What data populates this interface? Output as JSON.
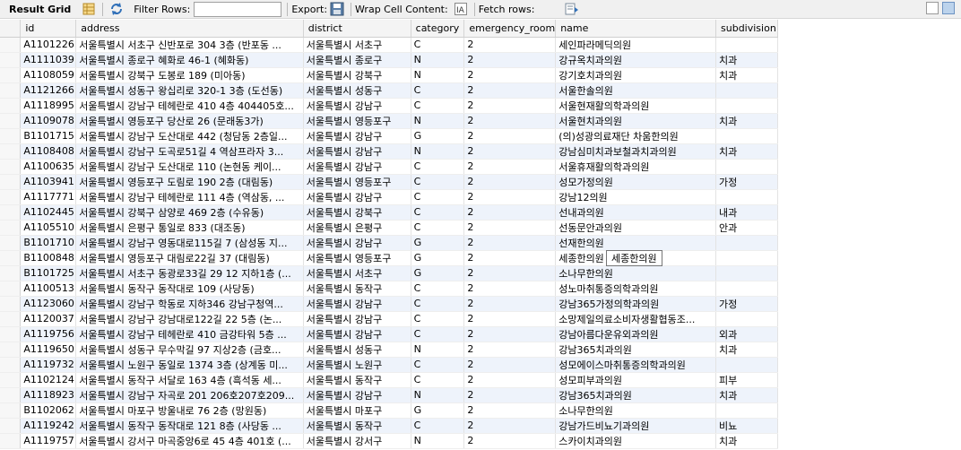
{
  "toolbar": {
    "result_grid": "Result Grid",
    "filter_rows": "Filter Rows:",
    "filter_value": "",
    "export": "Export:",
    "wrap_cell": "Wrap Cell Content:",
    "fetch_rows": "Fetch rows:"
  },
  "columns": [
    "id",
    "address",
    "district",
    "category",
    "emergency_room",
    "name",
    "subdivision"
  ],
  "rows": [
    [
      "A1101226",
      "서울특별시 서초구 신반포로 304 3층 (반포동 ...",
      "서울특별시 서초구",
      "C",
      "2",
      "세인파라메딕의원",
      ""
    ],
    [
      "A1111039",
      "서울특별시 종로구 혜화로 46-1 (혜화동)",
      "서울특별시 종로구",
      "N",
      "2",
      "강규옥치과의원",
      "치과"
    ],
    [
      "A1108059",
      "서울특별시 강북구 도봉로 189 (미아동)",
      "서울특별시 강북구",
      "N",
      "2",
      "강기호치과의원",
      "치과"
    ],
    [
      "A1121266",
      "서울특별시 성동구 왕십리로 320-1 3층 (도선동)",
      "서울특별시 성동구",
      "C",
      "2",
      "서울한솔의원",
      ""
    ],
    [
      "A1118995",
      "서울특별시 강남구 테헤란로 410 4층 404405호...",
      "서울특별시 강남구",
      "C",
      "2",
      "서울현재활의학과의원",
      ""
    ],
    [
      "A1109078",
      "서울특별시 영등포구 당산로 26 (문래동3가)",
      "서울특별시 영등포구",
      "N",
      "2",
      "서울현치과의원",
      "치과"
    ],
    [
      "B1101715",
      "서울특별시 강남구 도산대로 442 (청담동 2층일...",
      "서울특별시 강남구",
      "G",
      "2",
      "(의)성광의료재단 차움한의원",
      ""
    ],
    [
      "A1108408",
      "서울특별시 강남구 도곡로51길 4 역삼프라자 3...",
      "서울특별시 강남구",
      "N",
      "2",
      "강남심미치과보철과치과의원",
      "치과"
    ],
    [
      "A1100635",
      "서울특별시 강남구 도산대로 110 (논현동 케이...",
      "서울특별시 강남구",
      "C",
      "2",
      "서울휴재활의학과의원",
      ""
    ],
    [
      "A1103941",
      "서울특별시 영등포구 도림로 190 2층 (대림동)",
      "서울특별시 영등포구",
      "C",
      "2",
      "성모가정의원",
      "가정"
    ],
    [
      "A1117771",
      "서울특별시 강남구 테헤란로 111 4층 (역삼동, ...",
      "서울특별시 강남구",
      "C",
      "2",
      "강남12의원",
      ""
    ],
    [
      "A1102445",
      "서울특별시 강북구 삼양로 469 2층 (수유동)",
      "서울특별시 강북구",
      "C",
      "2",
      "선내과의원",
      "내과"
    ],
    [
      "A1105510",
      "서울특별시 은평구 통일로 833 (대조동)",
      "서울특별시 은평구",
      "C",
      "2",
      "선동문안과의원",
      "안과"
    ],
    [
      "B1101710",
      "서울특별시 강남구 영동대로115길 7 (삼성동 지...",
      "서울특별시 강남구",
      "G",
      "2",
      "선재한의원",
      ""
    ],
    [
      "B1100848",
      "서울특별시 영등포구 대림로22길 37 (대림동)",
      "서울특별시 영등포구",
      "G",
      "2",
      "세종한의원",
      ""
    ],
    [
      "B1101725",
      "서울특별시 서초구 동광로33길 29 12 지하1층 (...",
      "서울특별시 서초구",
      "G",
      "2",
      "소나무한의원",
      ""
    ],
    [
      "A1100513",
      "서울특별시 동작구 동작대로 109 (사당동)",
      "서울특별시 동작구",
      "C",
      "2",
      "성노마취통증의학과의원",
      ""
    ],
    [
      "A1123060",
      "서울특별시 강남구 학동로 지하346 강남구청역...",
      "서울특별시 강남구",
      "C",
      "2",
      "강남365가정의학과의원",
      "가정"
    ],
    [
      "A1120037",
      "서울특별시 강남구 강남대로122길 22 5층 (논...",
      "서울특별시 강남구",
      "C",
      "2",
      "소망제일의료소비자생활협동조...",
      ""
    ],
    [
      "A1119756",
      "서울특별시 강남구 테헤란로 410 금강타워 5층 ...",
      "서울특별시 강남구",
      "C",
      "2",
      "강남아름다운유외과의원",
      "외과"
    ],
    [
      "A1119650",
      "서울특별시 성동구 무수막길 97 지상2층 (금호...",
      "서울특별시 성동구",
      "N",
      "2",
      "강남365치과의원",
      "치과"
    ],
    [
      "A1119732",
      "서울특별시 노원구 동일로 1374 3층 (상계동 미...",
      "서울특별시 노원구",
      "C",
      "2",
      "성모에이스마취통증의학과의원",
      ""
    ],
    [
      "A1102124",
      "서울특별시 동작구 서달로 163 4층 (흑석동 세...",
      "서울특별시 동작구",
      "C",
      "2",
      "성모피부과의원",
      "피부"
    ],
    [
      "A1118923",
      "서울특별시 강남구 자곡로 201 206호207호209...",
      "서울특별시 강남구",
      "N",
      "2",
      "강남365치과의원",
      "치과"
    ],
    [
      "B1102062",
      "서울특별시 마포구 방울내로 76 2층 (망원동)",
      "서울특별시 마포구",
      "G",
      "2",
      "소나무한의원",
      ""
    ],
    [
      "A1119242",
      "서울특별시 동작구 동작대로 121 8층 (사당동 ...",
      "서울특별시 동작구",
      "C",
      "2",
      "강남가드비뇨기과의원",
      "비뇨"
    ],
    [
      "A1119757",
      "서울특별시 강서구 마곡중앙6로 45 4층 401호 (...",
      "서울특별시 강서구",
      "N",
      "2",
      "스카이치과의원",
      "치과"
    ]
  ],
  "tooltip": "세종한의원",
  "colors": {
    "accent": "#2f6fb8",
    "row_alt": "#eef3fb"
  }
}
